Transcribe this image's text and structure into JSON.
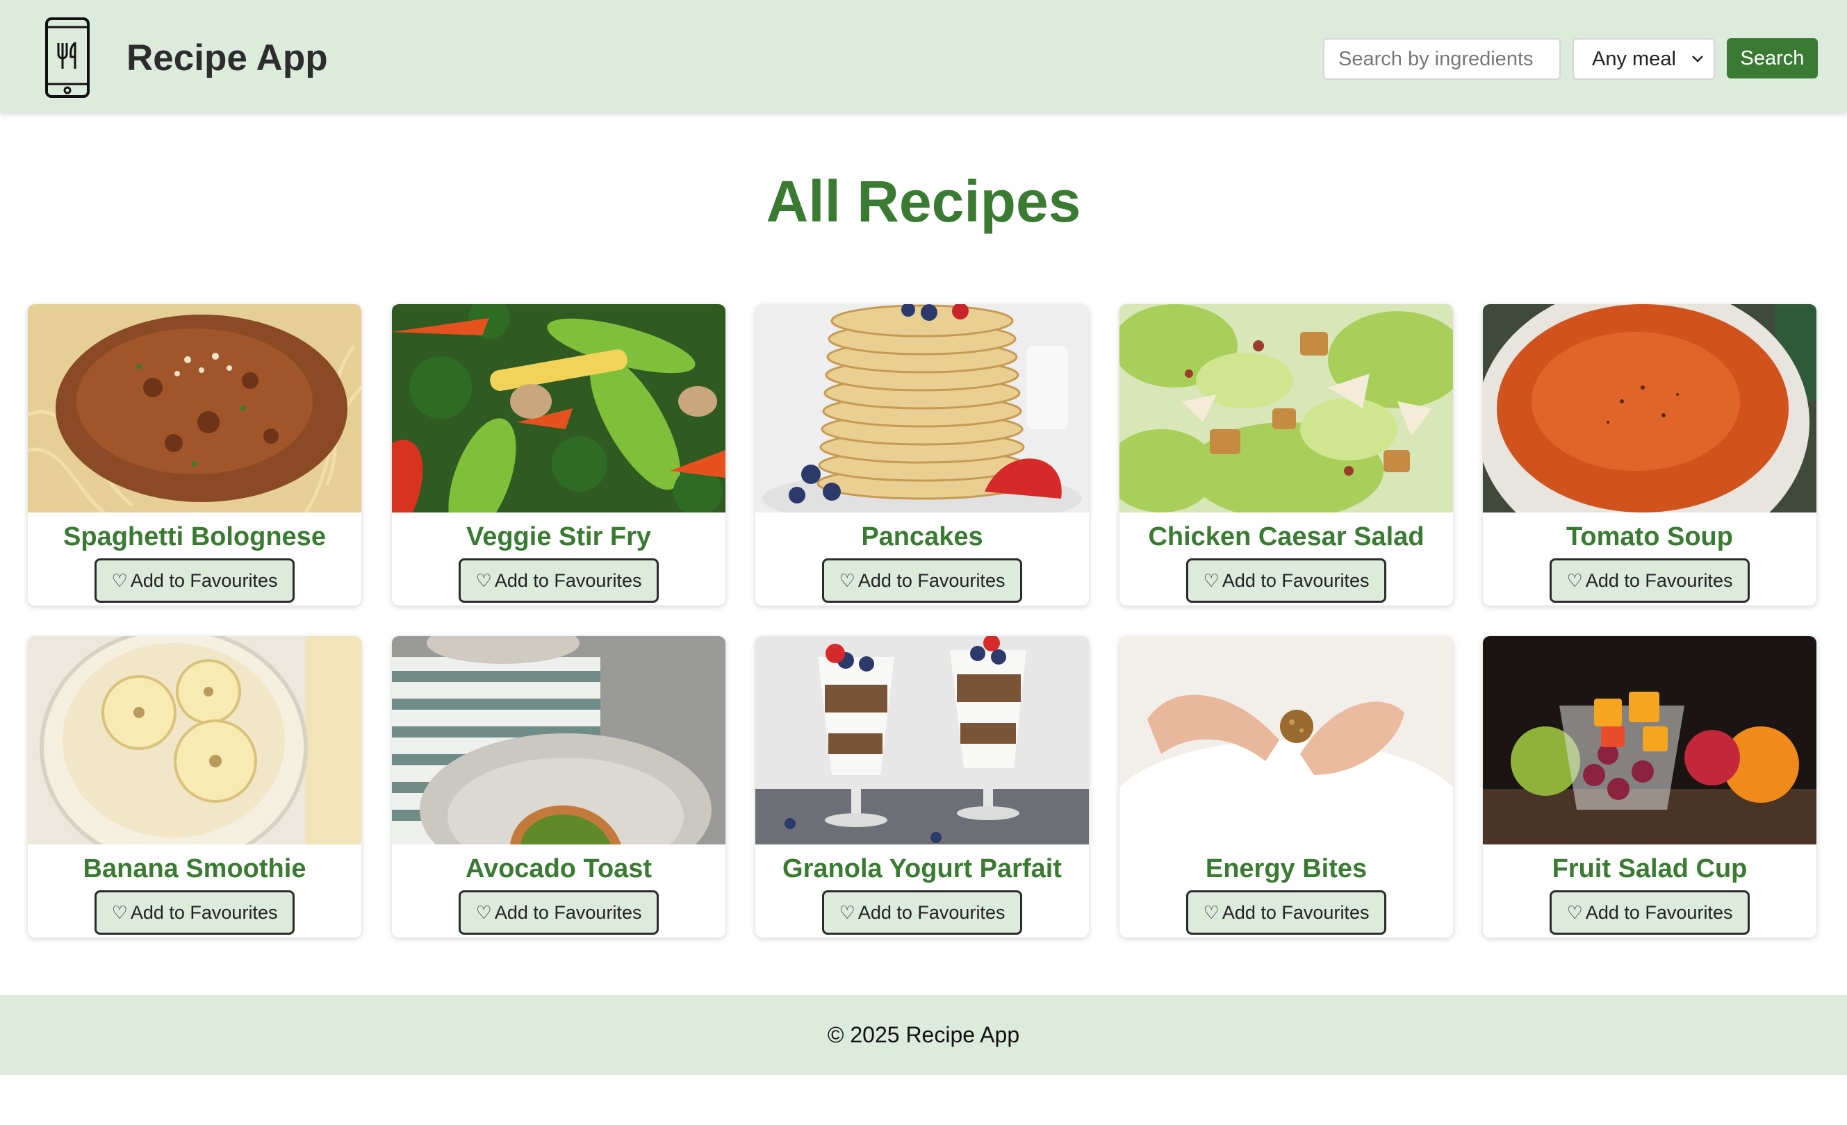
{
  "header": {
    "app_title": "Recipe App",
    "search_placeholder": "Search by ingredients",
    "meal_filter": "Any meal",
    "search_button": "Search"
  },
  "page_title": "All Recipes",
  "recipes": [
    {
      "title": "Spaghetti Bolognese",
      "button": "Add to Favourites",
      "image": "spaghetti-bolognese-photo"
    },
    {
      "title": "Veggie Stir Fry",
      "button": "Add to Favourites",
      "image": "veggie-stir-fry-photo"
    },
    {
      "title": "Pancakes",
      "button": "Add to Favourites",
      "image": "pancakes-photo"
    },
    {
      "title": "Chicken Caesar Salad",
      "button": "Add to Favourites",
      "image": "chicken-caesar-salad-photo"
    },
    {
      "title": "Tomato Soup",
      "button": "Add to Favourites",
      "image": "tomato-soup-photo"
    },
    {
      "title": "Banana Smoothie",
      "button": "Add to Favourites",
      "image": "banana-smoothie-photo"
    },
    {
      "title": "Avocado Toast",
      "button": "Add to Favourites",
      "image": "avocado-toast-photo"
    },
    {
      "title": "Granola Yogurt Parfait",
      "button": "Add to Favourites",
      "image": "granola-yogurt-parfait-photo"
    },
    {
      "title": "Energy Bites",
      "button": "Add to Favourites",
      "image": "energy-bites-photo"
    },
    {
      "title": "Fruit Salad Cup",
      "button": "Add to Favourites",
      "image": "fruit-salad-cup-photo"
    }
  ],
  "footer": {
    "text": "© 2025 Recipe App"
  },
  "colors": {
    "accent": "#3a7a32",
    "header_bg": "#dcebdc",
    "button_bg": "#dcebdc"
  }
}
